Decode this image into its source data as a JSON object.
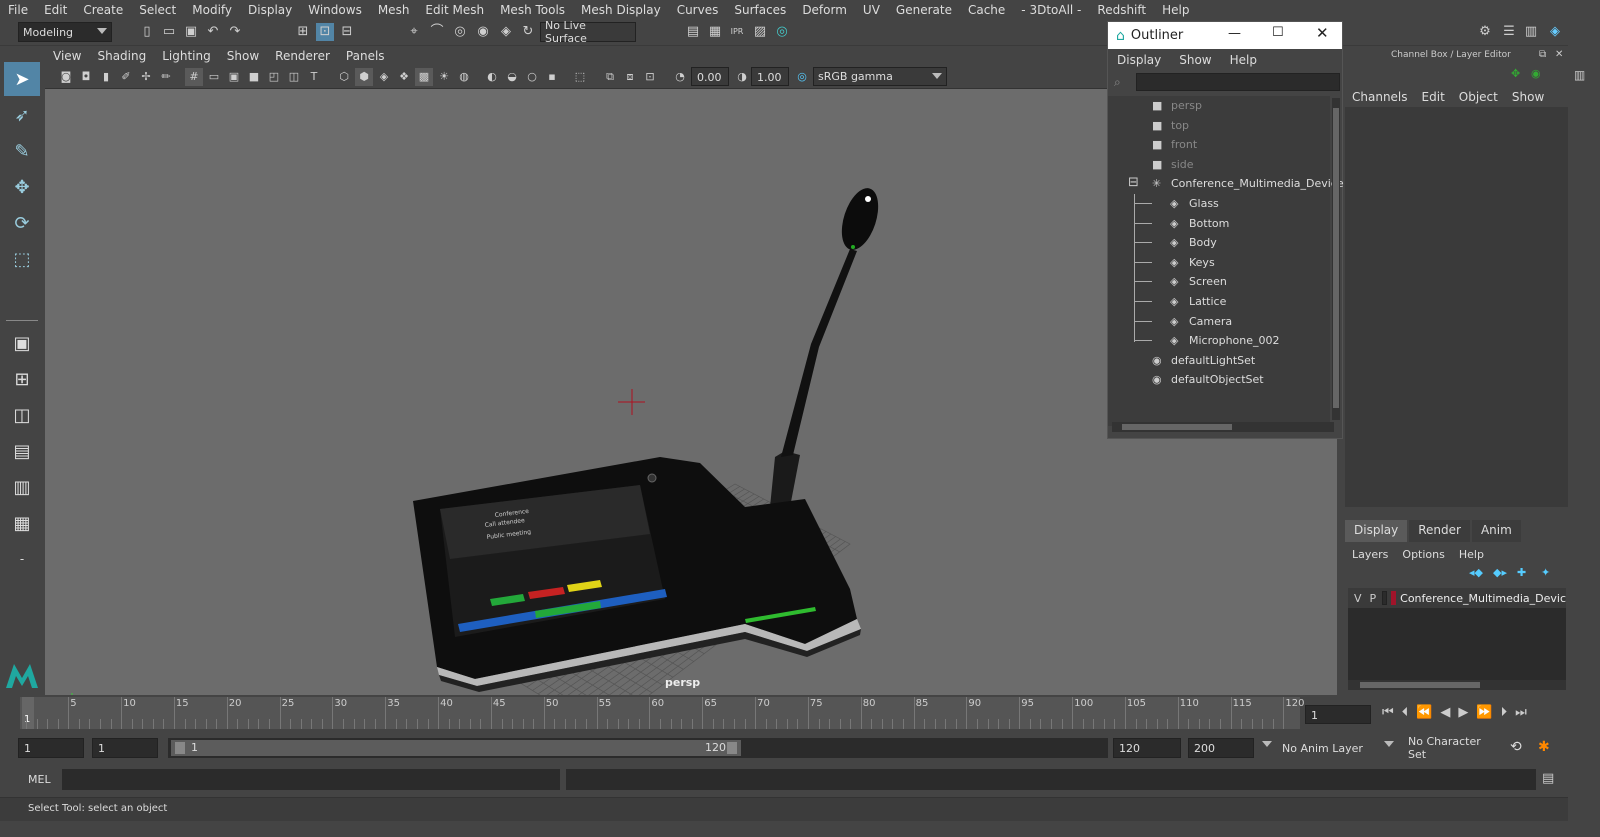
{
  "menubar": [
    "File",
    "Edit",
    "Create",
    "Select",
    "Modify",
    "Display",
    "Windows",
    "Mesh",
    "Edit Mesh",
    "Mesh Tools",
    "Mesh Display",
    "Curves",
    "Surfaces",
    "Deform",
    "UV",
    "Generate",
    "Cache",
    "- 3DtoAll -",
    "Redshift",
    "Help"
  ],
  "shelf": {
    "mode": "Modeling",
    "live_surface": "No Live Surface"
  },
  "viewport": {
    "menu": [
      "View",
      "Shading",
      "Lighting",
      "Show",
      "Renderer",
      "Panels"
    ],
    "exposure": "0.00",
    "gamma": "1.00",
    "colorspace": "sRGB gamma",
    "camera_label": "persp",
    "screen_lines": [
      "Conference",
      "Call attendee",
      "Public meeting"
    ]
  },
  "outliner": {
    "title": "Outliner",
    "menu": [
      "Display",
      "Show",
      "Help"
    ],
    "cameras": [
      "persp",
      "top",
      "front",
      "side"
    ],
    "group": "Conference_Multimedia_Device",
    "children": [
      "Glass",
      "Bottom",
      "Body",
      "Keys",
      "Screen",
      "Lattice",
      "Camera",
      "Microphone_002"
    ],
    "sets": [
      "defaultLightSet",
      "defaultObjectSet"
    ]
  },
  "channelbox": {
    "title": "Channel Box / Layer Editor",
    "menu": [
      "Channels",
      "Edit",
      "Object",
      "Show"
    ]
  },
  "layers": {
    "tabs": [
      "Display",
      "Render",
      "Anim"
    ],
    "menu": [
      "Layers",
      "Options",
      "Help"
    ],
    "layer_v": "V",
    "layer_p": "P",
    "layer_name": "Conference_Multimedia_Devic",
    "layer_color": "#a0142a"
  },
  "timeline": {
    "ticks": [
      "5",
      "10",
      "15",
      "20",
      "25",
      "30",
      "35",
      "40",
      "45",
      "50",
      "55",
      "60",
      "65",
      "70",
      "75",
      "80",
      "85",
      "90",
      "95",
      "100",
      "105",
      "110",
      "115",
      "120"
    ],
    "start_marker": "1",
    "current": "1"
  },
  "range": {
    "start": "1",
    "start2": "1",
    "slider_start": "1",
    "slider_end": "120",
    "end": "120",
    "end2": "200",
    "anim_layer": "No Anim Layer",
    "char_set": "No Character Set"
  },
  "cmd": {
    "label": "MEL"
  },
  "status": {
    "text": "Select Tool: select an object"
  }
}
